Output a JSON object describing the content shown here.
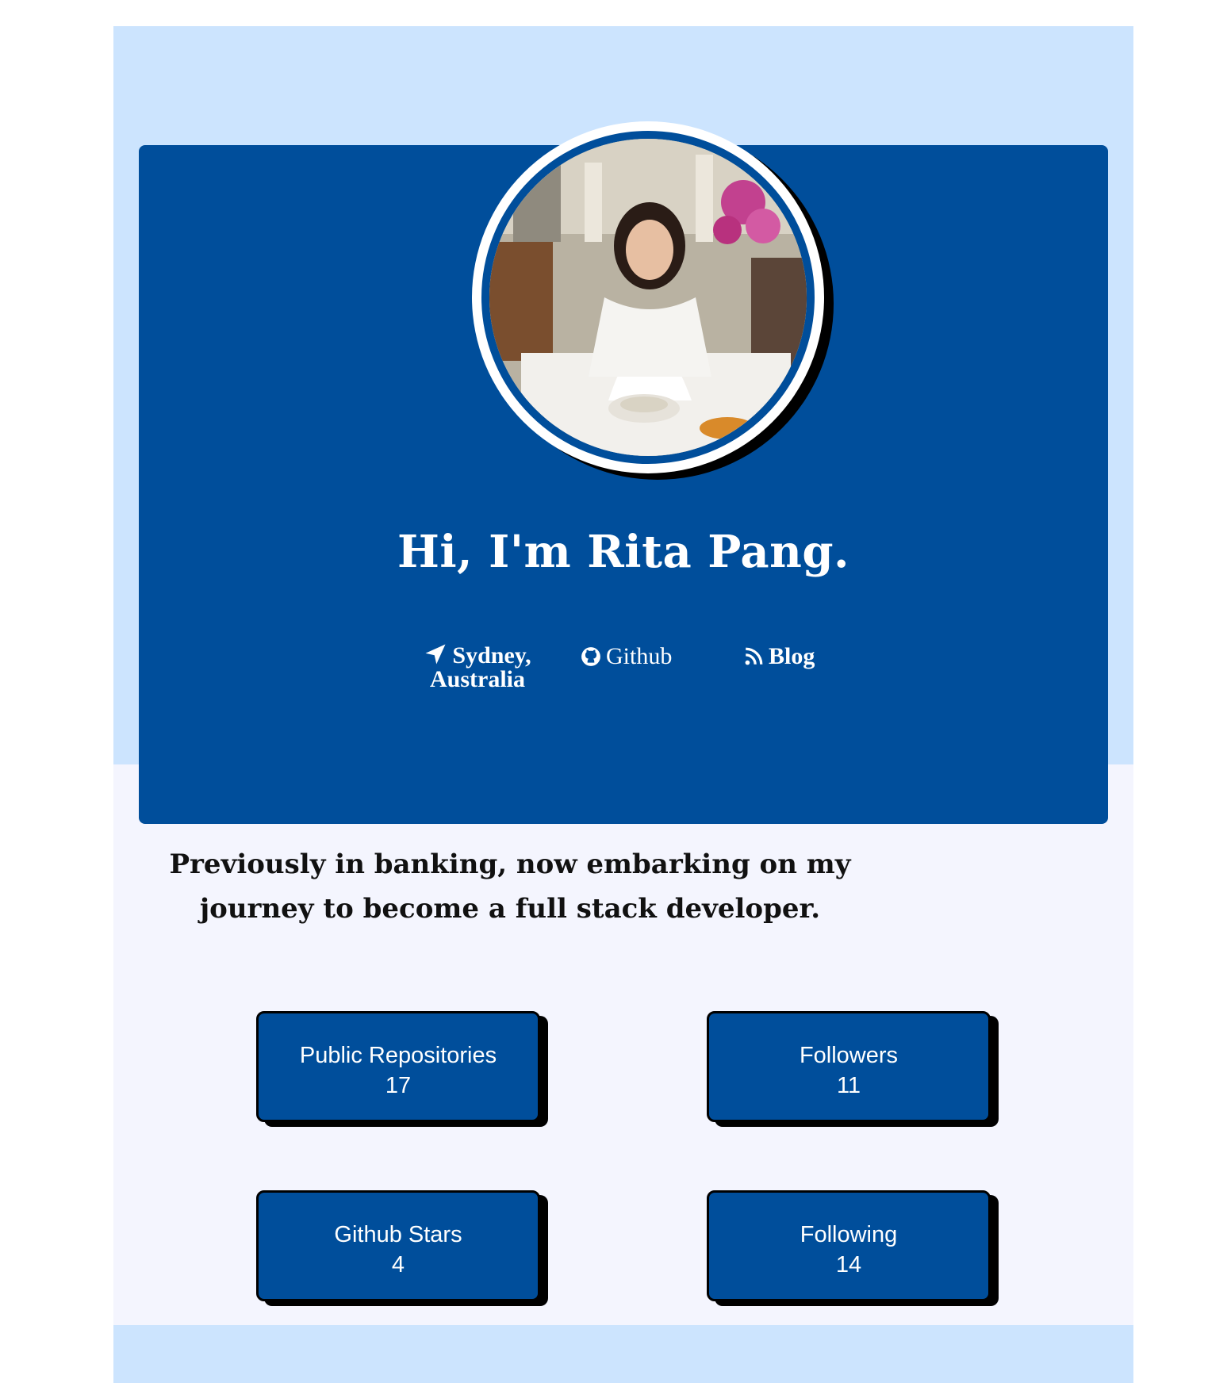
{
  "hero": {
    "title": "Hi, I'm Rita Pang.",
    "avatar_alt": "profile photo"
  },
  "links": {
    "location": {
      "icon": "location-arrow-icon",
      "label": "Sydney, Australia"
    },
    "github": {
      "icon": "github-icon",
      "label": "Github"
    },
    "blog": {
      "icon": "rss-icon",
      "label": "Blog"
    }
  },
  "tagline": "Previously in banking, now embarking on my journey to become a full stack developer.",
  "stats": [
    {
      "label": "Public Repositories",
      "value": "17"
    },
    {
      "label": "Followers",
      "value": "11"
    },
    {
      "label": "Github Stars",
      "value": "4"
    },
    {
      "label": "Following",
      "value": "14"
    }
  ],
  "colors": {
    "page_background": "#cce4fe",
    "lower_background": "#f4f5fe",
    "hero_blue": "#004e9b",
    "shadow": "#000000",
    "text_light": "#ffffff"
  }
}
